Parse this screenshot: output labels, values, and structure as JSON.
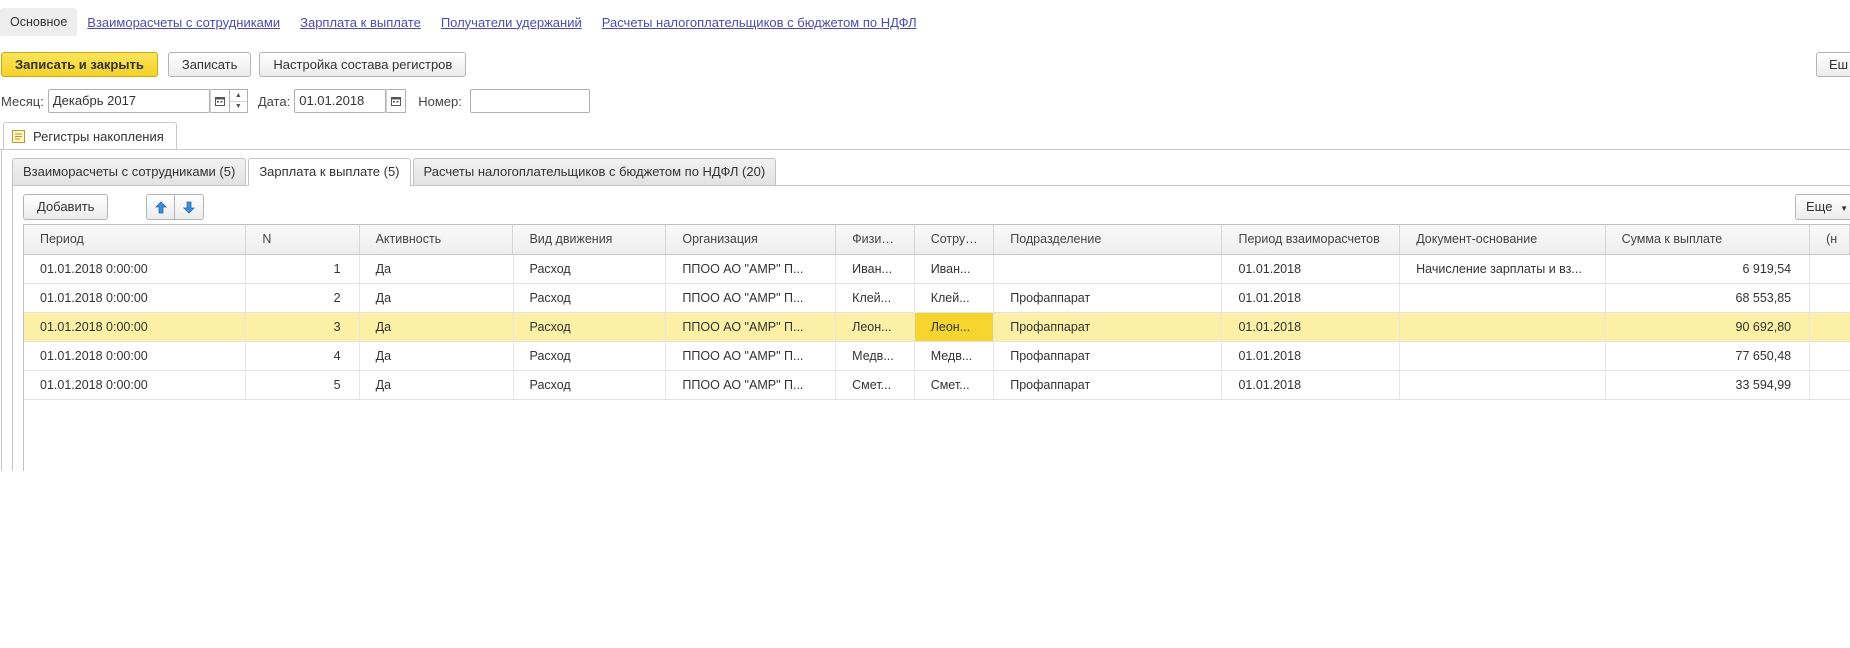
{
  "nav": {
    "active": "Основное",
    "links": [
      "Взаиморасчеты с сотрудниками",
      "Зарплата к выплате",
      "Получатели удержаний",
      "Расчеты налогоплательщиков с бюджетом по НДФЛ"
    ]
  },
  "toolbar": {
    "save_close": "Записать и закрыть",
    "save": "Записать",
    "registers_setup": "Настройка состава регистров",
    "more": "Еш"
  },
  "fields": {
    "month_label": "Месяц:",
    "month_value": "Декабрь 2017",
    "date_label": "Дата:",
    "date_value": "01.01.2018",
    "number_label": "Номер:",
    "number_value": ""
  },
  "group": {
    "title": "Регистры накопления"
  },
  "register_tabs": [
    "Взаиморасчеты с сотрудниками (5)",
    "Зарплата к выплате (5)",
    "Расчеты налогоплательщиков с бюджетом по НДФЛ (20)"
  ],
  "table_toolbar": {
    "add": "Добавить",
    "more": "Еще"
  },
  "columns": [
    "Период",
    "N",
    "Активность",
    "Вид движения",
    "Организация",
    "Физи…",
    "Сотру…",
    "Подразделение",
    "Период взаиморасчетов",
    "Документ-основание",
    "Сумма к выплате",
    "(н"
  ],
  "rows": [
    [
      "01.01.2018 0:00:00",
      "1",
      "Да",
      "Расход",
      "ППОО  АО \"АМР\"  П...",
      "Иван...",
      "Иван...",
      "",
      "01.01.2018",
      "Начисление зарплаты и вз...",
      "6 919,54",
      ""
    ],
    [
      "01.01.2018 0:00:00",
      "2",
      "Да",
      "Расход",
      "ППОО  АО \"АМР\"  П...",
      "Клей...",
      "Клей...",
      "Профаппарат",
      "01.01.2018",
      "",
      "68 553,85",
      ""
    ],
    [
      "01.01.2018 0:00:00",
      "3",
      "Да",
      "Расход",
      "ППОО  АО \"АМР\"  П...",
      "Леон...",
      "Леон...",
      "Профаппарат",
      "01.01.2018",
      "",
      "90 692,80",
      ""
    ],
    [
      "01.01.2018 0:00:00",
      "4",
      "Да",
      "Расход",
      "ППОО  АО \"АМР\"  П...",
      "Медв...",
      "Медв...",
      "Профаппарат",
      "01.01.2018",
      "",
      "77 650,48",
      ""
    ],
    [
      "01.01.2018 0:00:00",
      "5",
      "Да",
      "Расход",
      "ППОО  АО \"АМР\"  П...",
      "Смет...",
      "Смет...",
      "Профаппарат",
      "01.01.2018",
      "",
      "33 594,99",
      ""
    ]
  ],
  "colors": {
    "accent_yellow": "#f4d22b",
    "selected_row": "#fbf0a6",
    "link": "#4b4bb0"
  }
}
